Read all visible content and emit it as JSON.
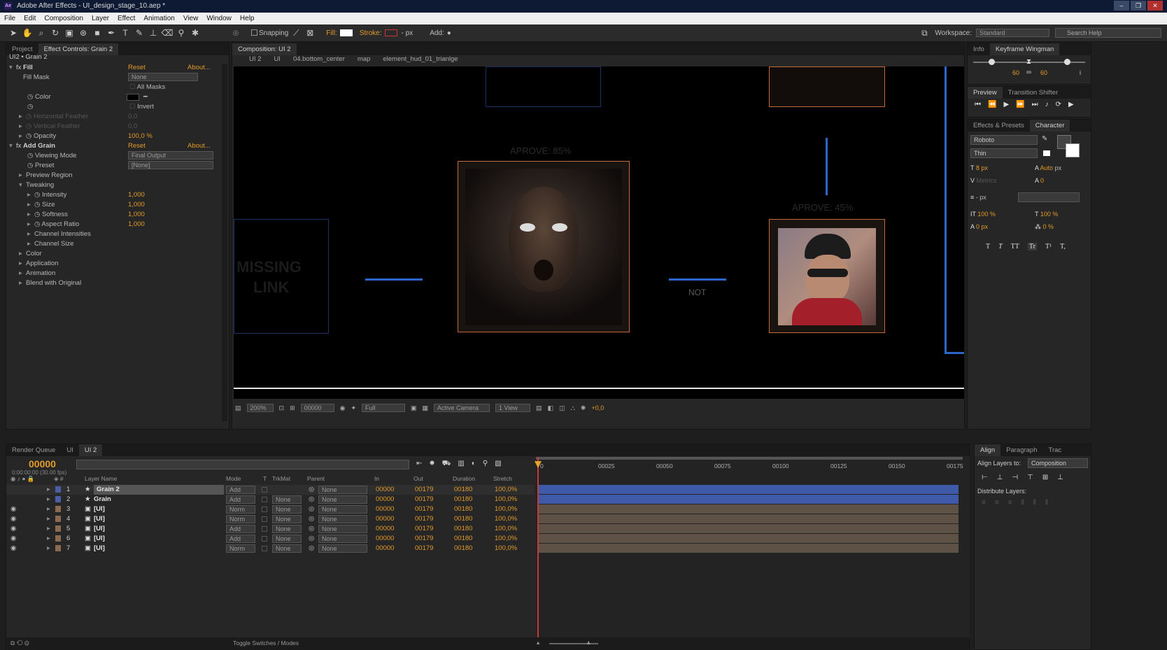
{
  "window": {
    "title": "Adobe After Effects - UI_design_stage_10.aep *",
    "app_icon": "Ae",
    "buttons": [
      "–",
      "❐",
      "✕"
    ]
  },
  "menu": [
    "File",
    "Edit",
    "Composition",
    "Layer",
    "Effect",
    "Animation",
    "View",
    "Window",
    "Help"
  ],
  "toolbar": {
    "snapping": "Snapping",
    "fill": "Fill:",
    "stroke": "Stroke:",
    "stroke_px": "- px",
    "add": "Add:",
    "workspace_label": "Workspace:",
    "workspace_value": "Standard",
    "search_placeholder": "Search Help"
  },
  "effect_panel": {
    "tabs": [
      "Project",
      "Effect Controls: Grain 2"
    ],
    "layer_path": "UI2 • Grain 2",
    "reset": "Reset",
    "about": "About...",
    "rows": [
      {
        "label": "Fill",
        "value": ""
      },
      {
        "label": "Fill Mask",
        "value": "None"
      },
      {
        "label": "",
        "value": "All Masks"
      },
      {
        "label": "Color",
        "value": ""
      },
      {
        "label": "",
        "value": "Invert"
      },
      {
        "label": "Horizontal Feather",
        "value": "0,0"
      },
      {
        "label": "Vertical Feather",
        "value": "0,0"
      },
      {
        "label": "Opacity",
        "value": "100,0 %"
      },
      {
        "label": "Add Grain",
        "value": ""
      },
      {
        "label": "Viewing Mode",
        "value": "Final Output"
      },
      {
        "label": "Preset",
        "value": "[None]"
      },
      {
        "label": "Preview Region",
        "value": ""
      },
      {
        "label": "Tweaking",
        "value": ""
      },
      {
        "label": "Intensity",
        "value": "1,000"
      },
      {
        "label": "Size",
        "value": "1,000"
      },
      {
        "label": "Softness",
        "value": "1,000"
      },
      {
        "label": "Aspect Ratio",
        "value": "1,000"
      },
      {
        "label": "Channel Intensities",
        "value": ""
      },
      {
        "label": "Channel Size",
        "value": ""
      },
      {
        "label": "Color",
        "value": ""
      },
      {
        "label": "Application",
        "value": ""
      },
      {
        "label": "Animation",
        "value": ""
      },
      {
        "label": "Blend with Original",
        "value": ""
      }
    ]
  },
  "composition": {
    "tab": "Composition: UI 2",
    "breadcrumbs": [
      "UI 2",
      "UI",
      "04.bottom_center",
      "map",
      "element_hud_01_trianlge"
    ],
    "text_aprove_85": "APROVE: 85%",
    "text_aprove_45": "APROVE: 45%",
    "text_missing": "MISSING",
    "text_link": "LINK",
    "text_not": "NOT",
    "footer": {
      "zoom": "200%",
      "timecode": "00000",
      "resolution": "Full",
      "camera": "Active Camera",
      "view": "1 View",
      "exposure": "+0,0"
    }
  },
  "right_panel": {
    "tabs_top": [
      "Info",
      "Keyframe Wingman"
    ],
    "wingman_val_left": "60",
    "wingman_val_right": "60",
    "preview_tabs": [
      "Preview",
      "Transition Shifter"
    ],
    "char_tabs": [
      "Effects & Presets",
      "Character"
    ],
    "font": "Roboto",
    "style": "Thin",
    "size": "8 px",
    "leading": "Auto",
    "leading_unit": "px",
    "kerning": "Metrics",
    "tracking": "0",
    "stroke_px": "- px",
    "vscale": "100 %",
    "hscale": "100 %",
    "baseline": "0 px",
    "tsume": "0 %",
    "type_buttons": [
      "T",
      "T",
      "TT",
      "Tr",
      "T¹",
      "T,"
    ]
  },
  "align_panel": {
    "tabs": [
      "Align",
      "Paragraph",
      "Trac"
    ],
    "align_to_label": "Align Layers to:",
    "align_to_value": "Composition",
    "distribute_label": "Distribute Layers:"
  },
  "timeline": {
    "tabs": [
      "Render Queue",
      "UI",
      "UI 2"
    ],
    "timecode": "00000",
    "timecode_sub": "0:00:00:00 (30.00 fps)",
    "columns": [
      "Layer Name",
      "Mode",
      "T",
      "TrkMat",
      "Parent",
      "In",
      "Out",
      "Duration",
      "Stretch"
    ],
    "ruler": [
      "0",
      "00025",
      "00050",
      "00075",
      "00100",
      "00125",
      "00150",
      "00175"
    ],
    "layers": [
      {
        "num": "1",
        "name": "Grain 2",
        "mode": "Add",
        "trkmat": "",
        "parent": "None",
        "in": "00000",
        "out": "00179",
        "dur": "00180",
        "stretch": "100,0%",
        "color": "#4a5fa8",
        "eye": false,
        "bar": "#3f5aa8"
      },
      {
        "num": "2",
        "name": "Grain",
        "mode": "Add",
        "trkmat": "None",
        "parent": "None",
        "in": "00000",
        "out": "00179",
        "dur": "00180",
        "stretch": "100,0%",
        "color": "#4a5fa8",
        "eye": false,
        "bar": "#3f5aa8"
      },
      {
        "num": "3",
        "name": "[UI]",
        "mode": "Norm",
        "trkmat": "None",
        "parent": "None",
        "in": "00000",
        "out": "00179",
        "dur": "00180",
        "stretch": "100,0%",
        "color": "#8a6a50",
        "eye": true,
        "bar": "#5e5247"
      },
      {
        "num": "4",
        "name": "[UI]",
        "mode": "Norm",
        "trkmat": "None",
        "parent": "None",
        "in": "00000",
        "out": "00179",
        "dur": "00180",
        "stretch": "100,0%",
        "color": "#8a6a50",
        "eye": true,
        "bar": "#5e5247"
      },
      {
        "num": "5",
        "name": "[UI]",
        "mode": "Add",
        "trkmat": "None",
        "parent": "None",
        "in": "00000",
        "out": "00179",
        "dur": "00180",
        "stretch": "100,0%",
        "color": "#8a6a50",
        "eye": true,
        "bar": "#5e5247"
      },
      {
        "num": "6",
        "name": "[UI]",
        "mode": "Add",
        "trkmat": "None",
        "parent": "None",
        "in": "00000",
        "out": "00179",
        "dur": "00180",
        "stretch": "100,0%",
        "color": "#8a6a50",
        "eye": true,
        "bar": "#5e5247"
      },
      {
        "num": "7",
        "name": "[UI]",
        "mode": "Norm",
        "trkmat": "None",
        "parent": "None",
        "in": "00000",
        "out": "00179",
        "dur": "00180",
        "stretch": "100,0%",
        "color": "#8a6a50",
        "eye": true,
        "bar": "#5e5247"
      }
    ],
    "footer": "Toggle Switches / Modes"
  }
}
